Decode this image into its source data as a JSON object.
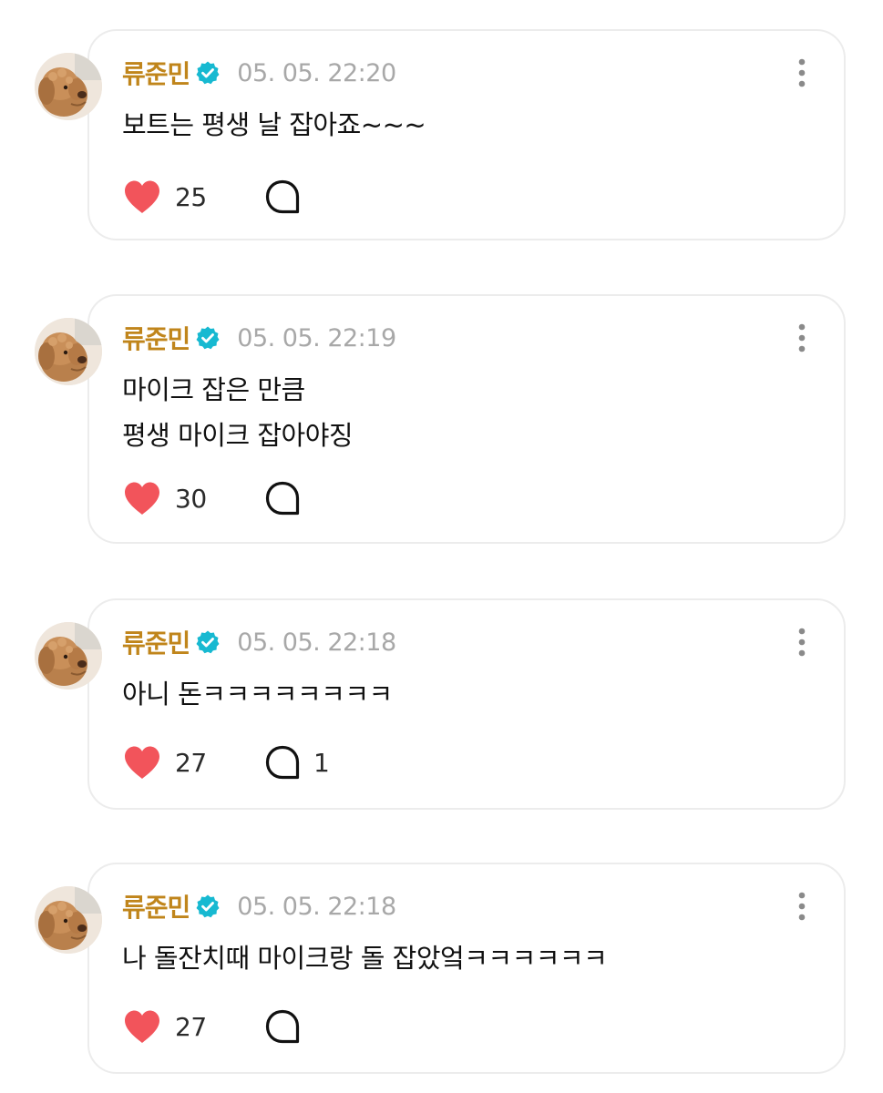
{
  "comments": [
    {
      "author": "류준민",
      "time": "05. 05. 22:20",
      "lines": [
        "보트는 평생 날 잡아죠~~~"
      ],
      "likes": "25",
      "replies": ""
    },
    {
      "author": "류준민",
      "time": "05. 05. 22:19",
      "lines": [
        "마이크 잡은 만큼",
        "평생 마이크 잡아야징"
      ],
      "likes": "30",
      "replies": ""
    },
    {
      "author": "류준민",
      "time": "05. 05. 22:18",
      "lines": [
        "아니 돈ㅋㅋㅋㅋㅋㅋㅋㅋ"
      ],
      "likes": "27",
      "replies": "1"
    },
    {
      "author": "류준민",
      "time": "05. 05. 22:18",
      "lines": [
        "나 돌잔치때 마이크랑 돌 잡았엌ㅋㅋㅋㅋㅋㅋ"
      ],
      "likes": "27",
      "replies": ""
    }
  ],
  "icons": {
    "verified": "verified-badge-icon",
    "more": "more-vertical-icon",
    "like": "heart-icon",
    "reply": "speech-bubble-icon"
  },
  "colors": {
    "author": "#c0851b",
    "verified": "#17b9d1",
    "heart": "#f2545b",
    "time": "#a8a8a8",
    "card_border": "#ececec"
  }
}
